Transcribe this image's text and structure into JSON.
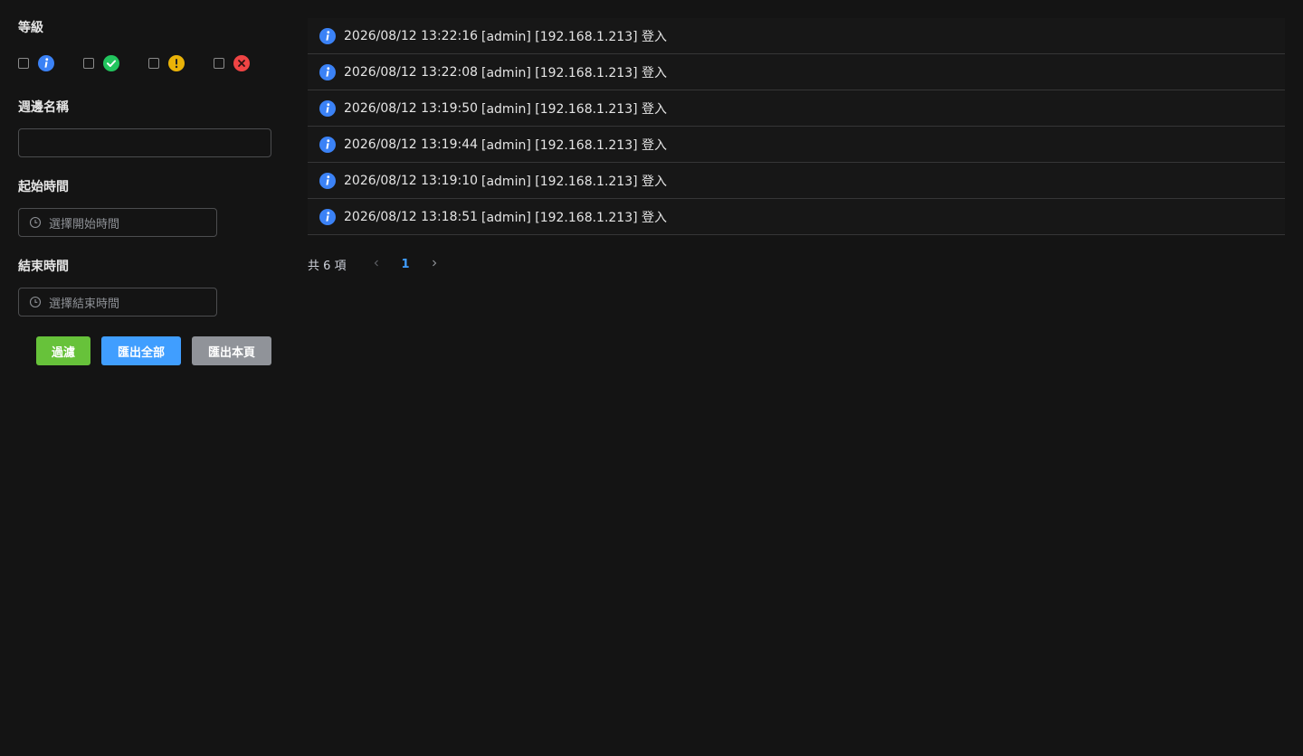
{
  "filters": {
    "level_label": "等級",
    "levels": [
      {
        "name": "info",
        "icon": "info-icon",
        "color": "#3b82f6",
        "checked": false
      },
      {
        "name": "success",
        "icon": "check-circle-icon",
        "color": "#22c55e",
        "checked": false
      },
      {
        "name": "warning",
        "icon": "exclamation-circle-icon",
        "color": "#eab308",
        "checked": false
      },
      {
        "name": "error",
        "icon": "close-circle-icon",
        "color": "#ef4444",
        "checked": false
      }
    ],
    "peripheral_label": "週邊名稱",
    "peripheral_value": "",
    "start_label": "起始時間",
    "start_placeholder": "選擇開始時間",
    "end_label": "結束時間",
    "end_placeholder": "選擇結束時間"
  },
  "actions": {
    "filter_label": "過濾",
    "export_all_label": "匯出全部",
    "export_page_label": "匯出本頁",
    "filter_color": "#67c23a",
    "export_all_color": "#409eff",
    "export_page_color": "#909399"
  },
  "logs": [
    {
      "level": "info",
      "time": "2026/08/12 13:22:16",
      "message": "[admin] [192.168.1.213] 登入"
    },
    {
      "level": "info",
      "time": "2026/08/12 13:22:08",
      "message": "[admin] [192.168.1.213] 登入"
    },
    {
      "level": "info",
      "time": "2026/08/12 13:19:50",
      "message": "[admin] [192.168.1.213] 登入"
    },
    {
      "level": "info",
      "time": "2026/08/12 13:19:44",
      "message": "[admin] [192.168.1.213] 登入"
    },
    {
      "level": "info",
      "time": "2026/08/12 13:19:10",
      "message": "[admin] [192.168.1.213] 登入"
    },
    {
      "level": "info",
      "time": "2026/08/12 13:18:51",
      "message": "[admin] [192.168.1.213] 登入"
    }
  ],
  "pagination": {
    "total_text": "共 6 項",
    "current_page": "1",
    "prev_icon": "chevron-left-icon",
    "next_icon": "chevron-right-icon",
    "active_color": "#409eff"
  }
}
